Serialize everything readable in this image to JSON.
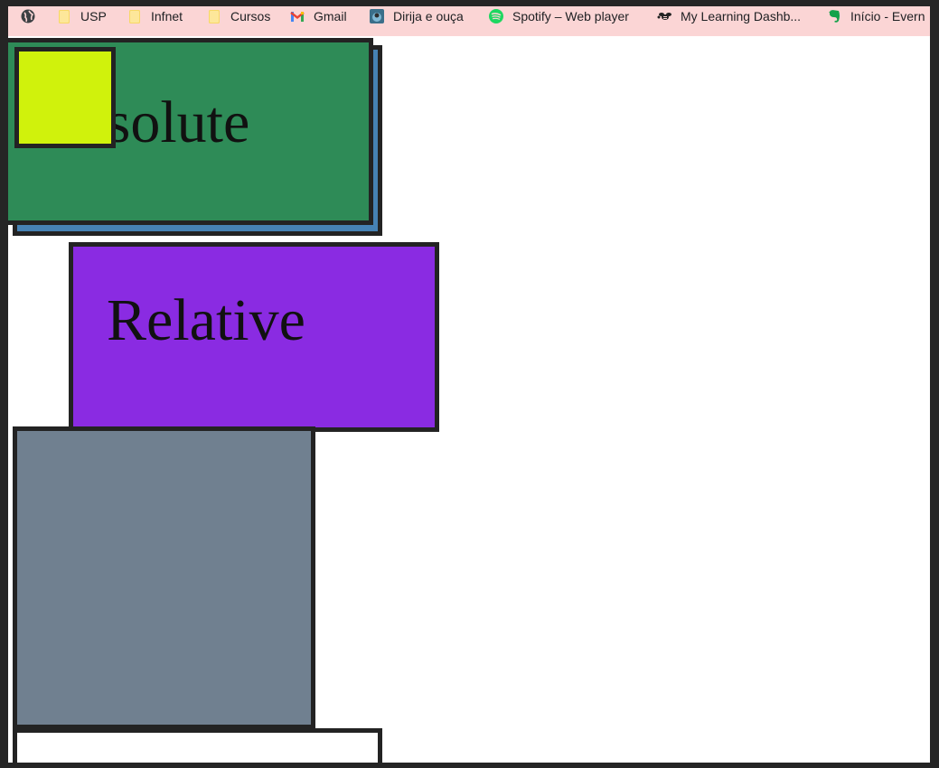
{
  "bookmarks": [
    {
      "label": "",
      "icon": "globe-icon"
    },
    {
      "label": "USP",
      "icon": "folder-icon"
    },
    {
      "label": "Infnet",
      "icon": "folder-icon"
    },
    {
      "label": "Cursos",
      "icon": "folder-icon"
    },
    {
      "label": "Gmail",
      "icon": "gmail-icon"
    },
    {
      "label": "Dirija e ouça",
      "icon": "app-icon"
    },
    {
      "label": "Spotify – Web player",
      "icon": "spotify-icon"
    },
    {
      "label": "My Learning Dashb...",
      "icon": "bee-icon"
    },
    {
      "label": "Início - Evern",
      "icon": "evernote-icon"
    }
  ],
  "boxes": {
    "absolute": {
      "label": "Absolute",
      "color": "#2e8b57"
    },
    "absolute_shadow": {
      "color": "#4682b4"
    },
    "yellow": {
      "color": "#d0f20c"
    },
    "relative": {
      "label": "Relative",
      "color": "#8a2be2"
    },
    "gray": {
      "color": "#708090"
    },
    "white": {
      "color": "#ffffff"
    }
  },
  "colors": {
    "bookmarks_bar": "#fbd5d5",
    "border": "#232323",
    "page_background": "#ffffff"
  }
}
